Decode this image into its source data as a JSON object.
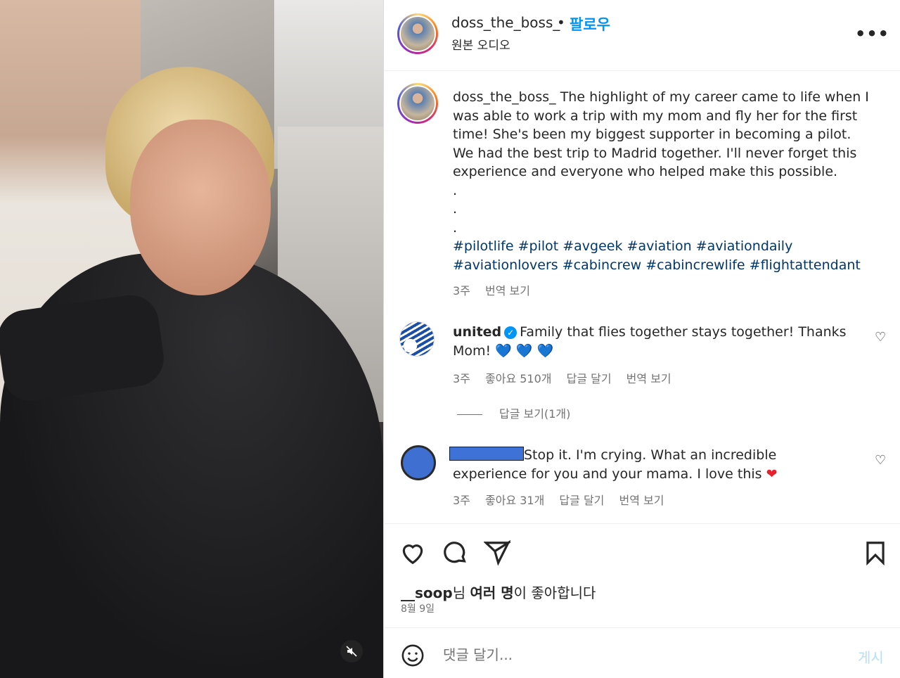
{
  "header": {
    "username": "doss_the_boss_",
    "separator": "•",
    "follow_label": "팔로우",
    "audio_label": "원본 오디오",
    "more_label": "•••"
  },
  "caption": {
    "username": "doss_the_boss_",
    "text": "The highlight of my career came to life when I was able to work a trip with my mom and fly her for the first time! She's been my biggest supporter in becoming a pilot. We had the best trip to Madrid together. I'll never forget this experience and everyone who helped make this possible.",
    "dots": [
      ".",
      ".",
      "."
    ],
    "hashtags": "#pilotlife #pilot #avgeek #aviation #aviationdaily #aviationlovers #cabincrew #cabincrewlife #flightattendant",
    "time": "3주",
    "translate_label": "번역 보기"
  },
  "comments": [
    {
      "username": "united",
      "verified": "✓",
      "text": "Family that flies together stays together! Thanks Mom!",
      "emoji": "💙 💙 💙",
      "time": "3주",
      "likes": "좋아요 510개",
      "reply_label": "답글 달기",
      "translate_label": "번역 보기",
      "view_replies": "답글 보기(1개)"
    },
    {
      "username": "",
      "text": "Stop it. I'm crying. What an incredible experience for you and your mama. I love this",
      "emoji": "❤",
      "time": "3주",
      "likes": "좋아요 31개",
      "reply_label": "답글 달기",
      "translate_label": "번역 보기"
    }
  ],
  "likes_summary": {
    "user": "__soop",
    "suffix_1": "님 ",
    "bold": "여러 명",
    "suffix_2": "이 좋아합니다"
  },
  "date": "8월 9일",
  "comment_box": {
    "placeholder": "댓글 달기...",
    "post_label": "게시"
  },
  "colors": {
    "follow": "#0095f6",
    "hashtag": "#00376b",
    "secondary_text": "#737373",
    "post_disabled": "#b2dffc"
  }
}
